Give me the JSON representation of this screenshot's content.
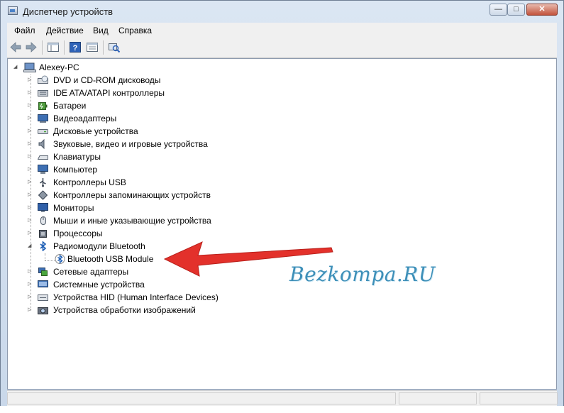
{
  "window": {
    "title": "Диспетчер устройств"
  },
  "menu": {
    "file": "Файл",
    "action": "Действие",
    "view": "Вид",
    "help": "Справка"
  },
  "tree": {
    "root": "Alexey-PC",
    "items": [
      {
        "label": "DVD и CD-ROM дисководы",
        "icon": "dvd-drive-icon"
      },
      {
        "label": "IDE ATA/ATAPI контроллеры",
        "icon": "ide-controller-icon"
      },
      {
        "label": "Батареи",
        "icon": "battery-icon"
      },
      {
        "label": "Видеоадаптеры",
        "icon": "display-adapter-icon"
      },
      {
        "label": "Дисковые устройства",
        "icon": "disk-drive-icon"
      },
      {
        "label": "Звуковые, видео и игровые устройства",
        "icon": "speaker-icon"
      },
      {
        "label": "Клавиатуры",
        "icon": "keyboard-icon"
      },
      {
        "label": "Компьютер",
        "icon": "computer-icon"
      },
      {
        "label": "Контроллеры USB",
        "icon": "usb-icon"
      },
      {
        "label": "Контроллеры запоминающих устройств",
        "icon": "storage-controller-icon"
      },
      {
        "label": "Мониторы",
        "icon": "monitor-icon"
      },
      {
        "label": "Мыши и иные указывающие устройства",
        "icon": "mouse-icon"
      },
      {
        "label": "Процессоры",
        "icon": "processor-icon"
      },
      {
        "label": "Радиомодули Bluetooth",
        "icon": "bluetooth-icon",
        "expanded": true,
        "child": "Bluetooth USB Module"
      },
      {
        "label": "Сетевые адаптеры",
        "icon": "network-adapter-icon"
      },
      {
        "label": "Системные устройства",
        "icon": "system-device-icon"
      },
      {
        "label": "Устройства HID (Human Interface Devices)",
        "icon": "hid-icon"
      },
      {
        "label": "Устройства обработки изображений",
        "icon": "imaging-device-icon"
      }
    ]
  },
  "watermark": "Bezkompa.RU",
  "colors": {
    "arrow": "#e3312b",
    "watermark": "#3d8fb8",
    "bluetooth": "#1f5fb5"
  }
}
